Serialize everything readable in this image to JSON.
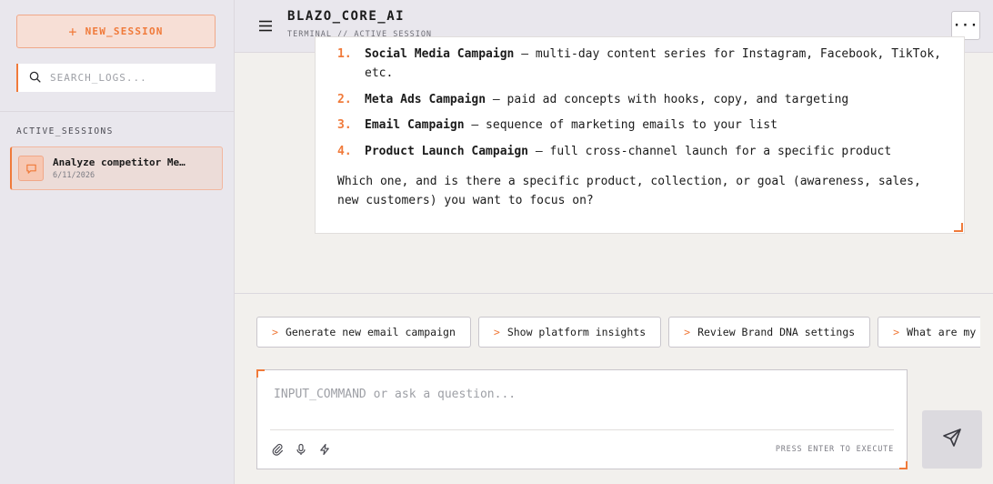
{
  "sidebar": {
    "new_session_label": "NEW_SESSION",
    "search_placeholder": "SEARCH_LOGS...",
    "sessions_heading": "ACTIVE_SESSIONS",
    "sessions": [
      {
        "title": "Analyze competitor Me…",
        "date": "6/11/2026"
      }
    ]
  },
  "header": {
    "title": "BLAZO_CORE_AI",
    "subtitle": "TERMINAL // ACTIVE_SESSION",
    "more_label": "···"
  },
  "message": {
    "items": [
      {
        "num": "1.",
        "title": "Social Media Campaign",
        "desc": " — multi-day content series for Instagram, Facebook, TikTok, etc."
      },
      {
        "num": "2.",
        "title": "Meta Ads Campaign",
        "desc": " — paid ad concepts with hooks, copy, and targeting"
      },
      {
        "num": "3.",
        "title": "Email Campaign",
        "desc": " — sequence of marketing emails to your list"
      },
      {
        "num": "4.",
        "title": "Product Launch Campaign",
        "desc": " — full cross-channel launch for a specific product"
      }
    ],
    "question": "Which one, and is there a specific product, collection, or goal (awareness, sales, new customers) you want to focus on?"
  },
  "suggestions": [
    {
      "prefix": ">",
      "label": "Generate new email campaign"
    },
    {
      "prefix": ">",
      "label": "Show platform insights"
    },
    {
      "prefix": ">",
      "label": "Review Brand DNA settings"
    },
    {
      "prefix": ">",
      "label": "What are my pending tasks?"
    }
  ],
  "composer": {
    "placeholder": "INPUT_COMMAND or ask a question...",
    "hint": "PRESS ENTER TO EXECUTE"
  },
  "colors": {
    "accent": "#f07a3a",
    "sidebar_bg": "#e9e7ed",
    "main_bg": "#f2f0ed"
  },
  "icons": {
    "new_session": "plus-icon",
    "search": "search-icon",
    "session": "chat-bubble-icon",
    "menu": "hamburger-icon",
    "more": "more-icon",
    "attach": "paperclip-icon",
    "mic": "microphone-icon",
    "bolt": "lightning-icon",
    "send": "send-icon"
  }
}
